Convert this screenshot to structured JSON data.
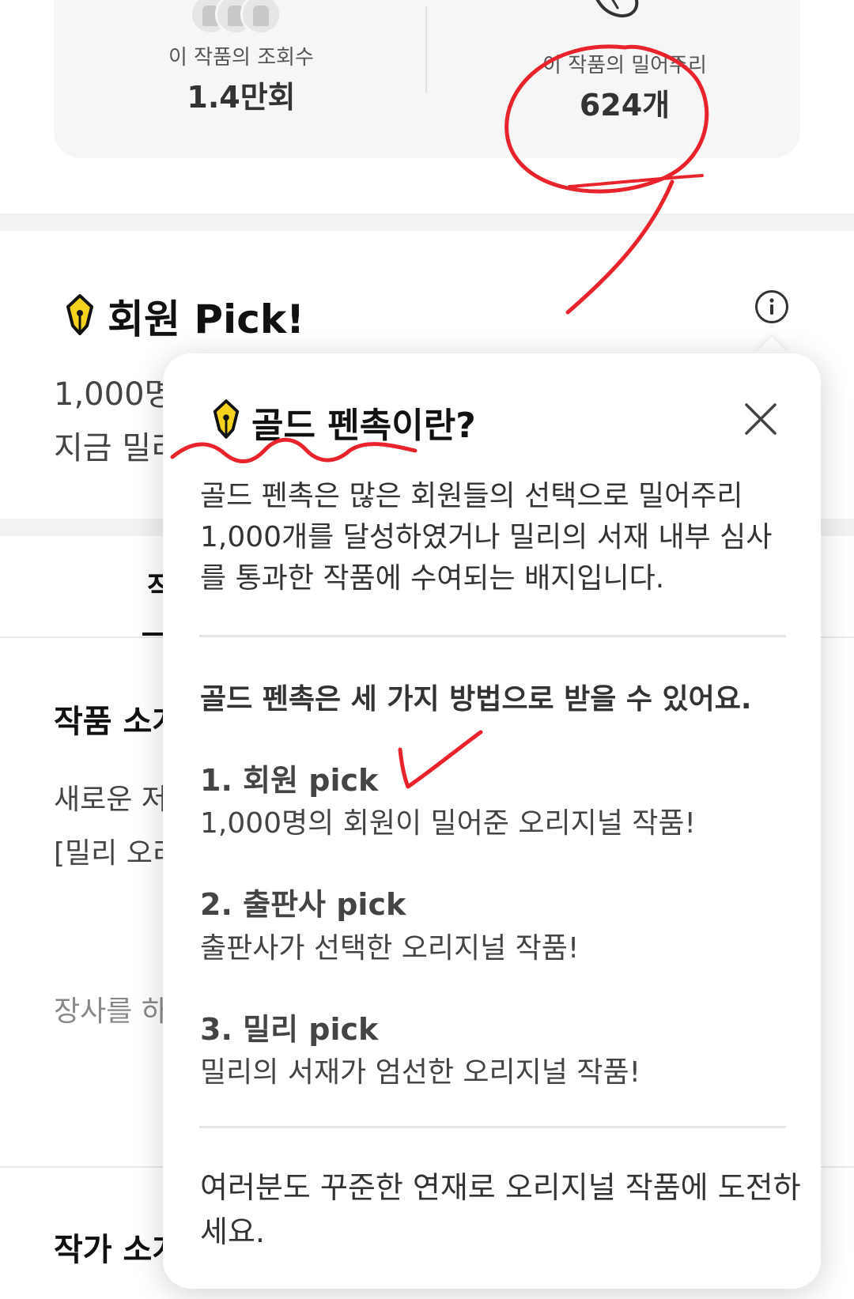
{
  "stats": {
    "views_label": "이 작품의 조회수",
    "views_value": "1.4만회",
    "likes_label": "이 작품의 밀어주리",
    "likes_value": "624개"
  },
  "pick_section": {
    "title": "회원 Pick!",
    "line1": "1,000명",
    "line2": "지금 밀리"
  },
  "tabs": {
    "partial_label": "작"
  },
  "intro_section": {
    "title": "작품 소개",
    "line1": "새로운 저",
    "line2": "[밀리 오리",
    "muted_line": "장사를 하"
  },
  "author_section": {
    "title": "작가 소개"
  },
  "popup": {
    "title": "골드 펜촉이란?",
    "description_lines": [
      "골드 펜촉은 많은 회원들의 선택으로 밀어주리",
      "1,000개를 달성하였거나 밀리의 서재 내부 심사",
      "를 통과한 작품에 수여되는 배지입니다."
    ],
    "methods_heading": "골드 펜촉은 세 가지 방법으로 받을 수 있어요.",
    "methods": [
      {
        "title": "1. 회원 pick",
        "desc": "1,000명의 회원이 밀어준 오리지널 작품!"
      },
      {
        "title": "2. 출판사 pick",
        "desc": "출판사가 선택한 오리지널 작품!"
      },
      {
        "title": "3. 밀리 pick",
        "desc": "밀리의 서재가 엄선한 오리지널 작품!"
      }
    ],
    "footer_lines": [
      "여러분도 꾸준한 연재로 오리지널 작품에 도전하",
      "세요."
    ]
  },
  "colors": {
    "gold_badge": "#f5d21e",
    "annotation_red": "#e8232b",
    "card_bg": "#f6f6f6"
  },
  "icons": [
    "gold-pen-nib-icon",
    "info-icon",
    "close-icon",
    "hand-icon"
  ]
}
